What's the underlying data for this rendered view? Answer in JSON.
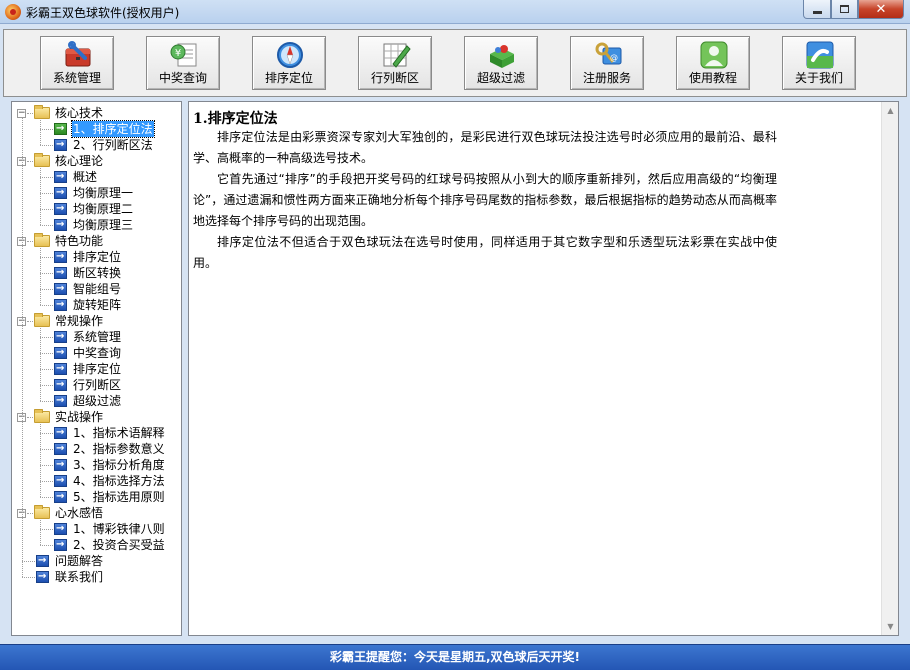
{
  "window": {
    "title": "彩霸王双色球软件(授权用户)",
    "close_glyph": "✕"
  },
  "toolbar": {
    "buttons": [
      {
        "label": "系统管理",
        "icon": "toolbox-icon"
      },
      {
        "label": "中奖查询",
        "icon": "lottery-ticket-icon"
      },
      {
        "label": "排序定位",
        "icon": "compass-icon"
      },
      {
        "label": "行列断区",
        "icon": "grid-pencil-icon"
      },
      {
        "label": "超级过滤",
        "icon": "filter-box-icon"
      },
      {
        "label": "注册服务",
        "icon": "keys-icon"
      },
      {
        "label": "使用教程",
        "icon": "user-tutorial-icon"
      },
      {
        "label": "关于我们",
        "icon": "phone-contact-icon"
      }
    ]
  },
  "tree": {
    "collapse_glyph": "−",
    "nodes": [
      {
        "label": "核心技术",
        "type": "folder",
        "level": 0
      },
      {
        "label": "1、排序定位法",
        "type": "doc",
        "level": 1,
        "selected": true
      },
      {
        "label": "2、行列断区法",
        "type": "doc",
        "level": 1
      },
      {
        "label": "核心理论",
        "type": "folder",
        "level": 0
      },
      {
        "label": "概述",
        "type": "doc",
        "level": 1
      },
      {
        "label": "均衡原理一",
        "type": "doc",
        "level": 1
      },
      {
        "label": "均衡原理二",
        "type": "doc",
        "level": 1
      },
      {
        "label": "均衡原理三",
        "type": "doc",
        "level": 1
      },
      {
        "label": "特色功能",
        "type": "folder",
        "level": 0
      },
      {
        "label": "排序定位",
        "type": "doc",
        "level": 1
      },
      {
        "label": "断区转换",
        "type": "doc",
        "level": 1
      },
      {
        "label": "智能组号",
        "type": "doc",
        "level": 1
      },
      {
        "label": "旋转矩阵",
        "type": "doc",
        "level": 1
      },
      {
        "label": "常规操作",
        "type": "folder",
        "level": 0
      },
      {
        "label": "系统管理",
        "type": "doc",
        "level": 1
      },
      {
        "label": "中奖查询",
        "type": "doc",
        "level": 1
      },
      {
        "label": "排序定位",
        "type": "doc",
        "level": 1
      },
      {
        "label": "行列断区",
        "type": "doc",
        "level": 1
      },
      {
        "label": "超级过滤",
        "type": "doc",
        "level": 1
      },
      {
        "label": "实战操作",
        "type": "folder",
        "level": 0
      },
      {
        "label": "1、指标术语解释",
        "type": "doc",
        "level": 1
      },
      {
        "label": "2、指标参数意义",
        "type": "doc",
        "level": 1
      },
      {
        "label": "3、指标分析角度",
        "type": "doc",
        "level": 1
      },
      {
        "label": "4、指标选择方法",
        "type": "doc",
        "level": 1
      },
      {
        "label": "5、指标选用原则",
        "type": "doc",
        "level": 1
      },
      {
        "label": "心水感悟",
        "type": "folder",
        "level": 0
      },
      {
        "label": "1、博彩铁律八则",
        "type": "doc",
        "level": 1
      },
      {
        "label": "2、投资合买受益",
        "type": "doc",
        "level": 1
      },
      {
        "label": "问题解答",
        "type": "doc",
        "level": 0
      },
      {
        "label": "联系我们",
        "type": "doc",
        "level": 0
      }
    ]
  },
  "content": {
    "heading": "1.排序定位法",
    "paragraphs": [
      "排序定位法是由彩票资深专家刘大军独创的，是彩民进行双色球玩法投注选号时必须应用的最前沿、最科学、高概率的一种高级选号技术。",
      "它首先通过“排序”的手段把开奖号码的红球号码按照从小到大的顺序重新排列，然后应用高级的“均衡理论”，通过遗漏和惯性两方面来正确地分析每个排序号码尾数的指标参数，最后根据指标的趋势动态从而高概率地选择每个排序号码的出现范围。",
      "排序定位法不但适合于双色球玩法在选号时使用，同样适用于其它数字型和乐透型玩法彩票在实战中使用。"
    ]
  },
  "status": {
    "message": "彩霸王提醒您：今天是星期五,双色球后天开奖!"
  }
}
